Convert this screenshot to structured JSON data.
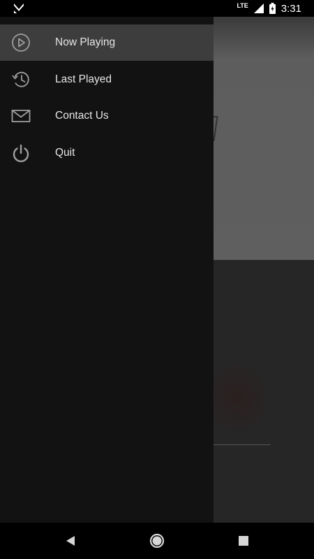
{
  "status_bar": {
    "time": "3:31",
    "network_label": "LTE",
    "left_icon": "app-notification-icon",
    "signal_icon": "signal-icon",
    "battery_icon": "battery-charging-icon"
  },
  "drawer": {
    "items": [
      {
        "label": "Now Playing",
        "icon": "play-circle-icon",
        "active": true
      },
      {
        "label": "Last Played",
        "icon": "history-icon",
        "active": false
      },
      {
        "label": "Contact Us",
        "icon": "envelope-icon",
        "active": false
      },
      {
        "label": "Quit",
        "icon": "power-icon",
        "active": false
      }
    ]
  },
  "nav_bar": {
    "back_icon": "back-triangle-icon",
    "home_icon": "home-circle-icon",
    "recents_icon": "recents-square-icon"
  },
  "colors": {
    "drawer_bg": "#121212",
    "active_item_bg": "#3d3d3d",
    "icon_color": "#9e9e9e",
    "text_color": "#e6e6e6"
  }
}
